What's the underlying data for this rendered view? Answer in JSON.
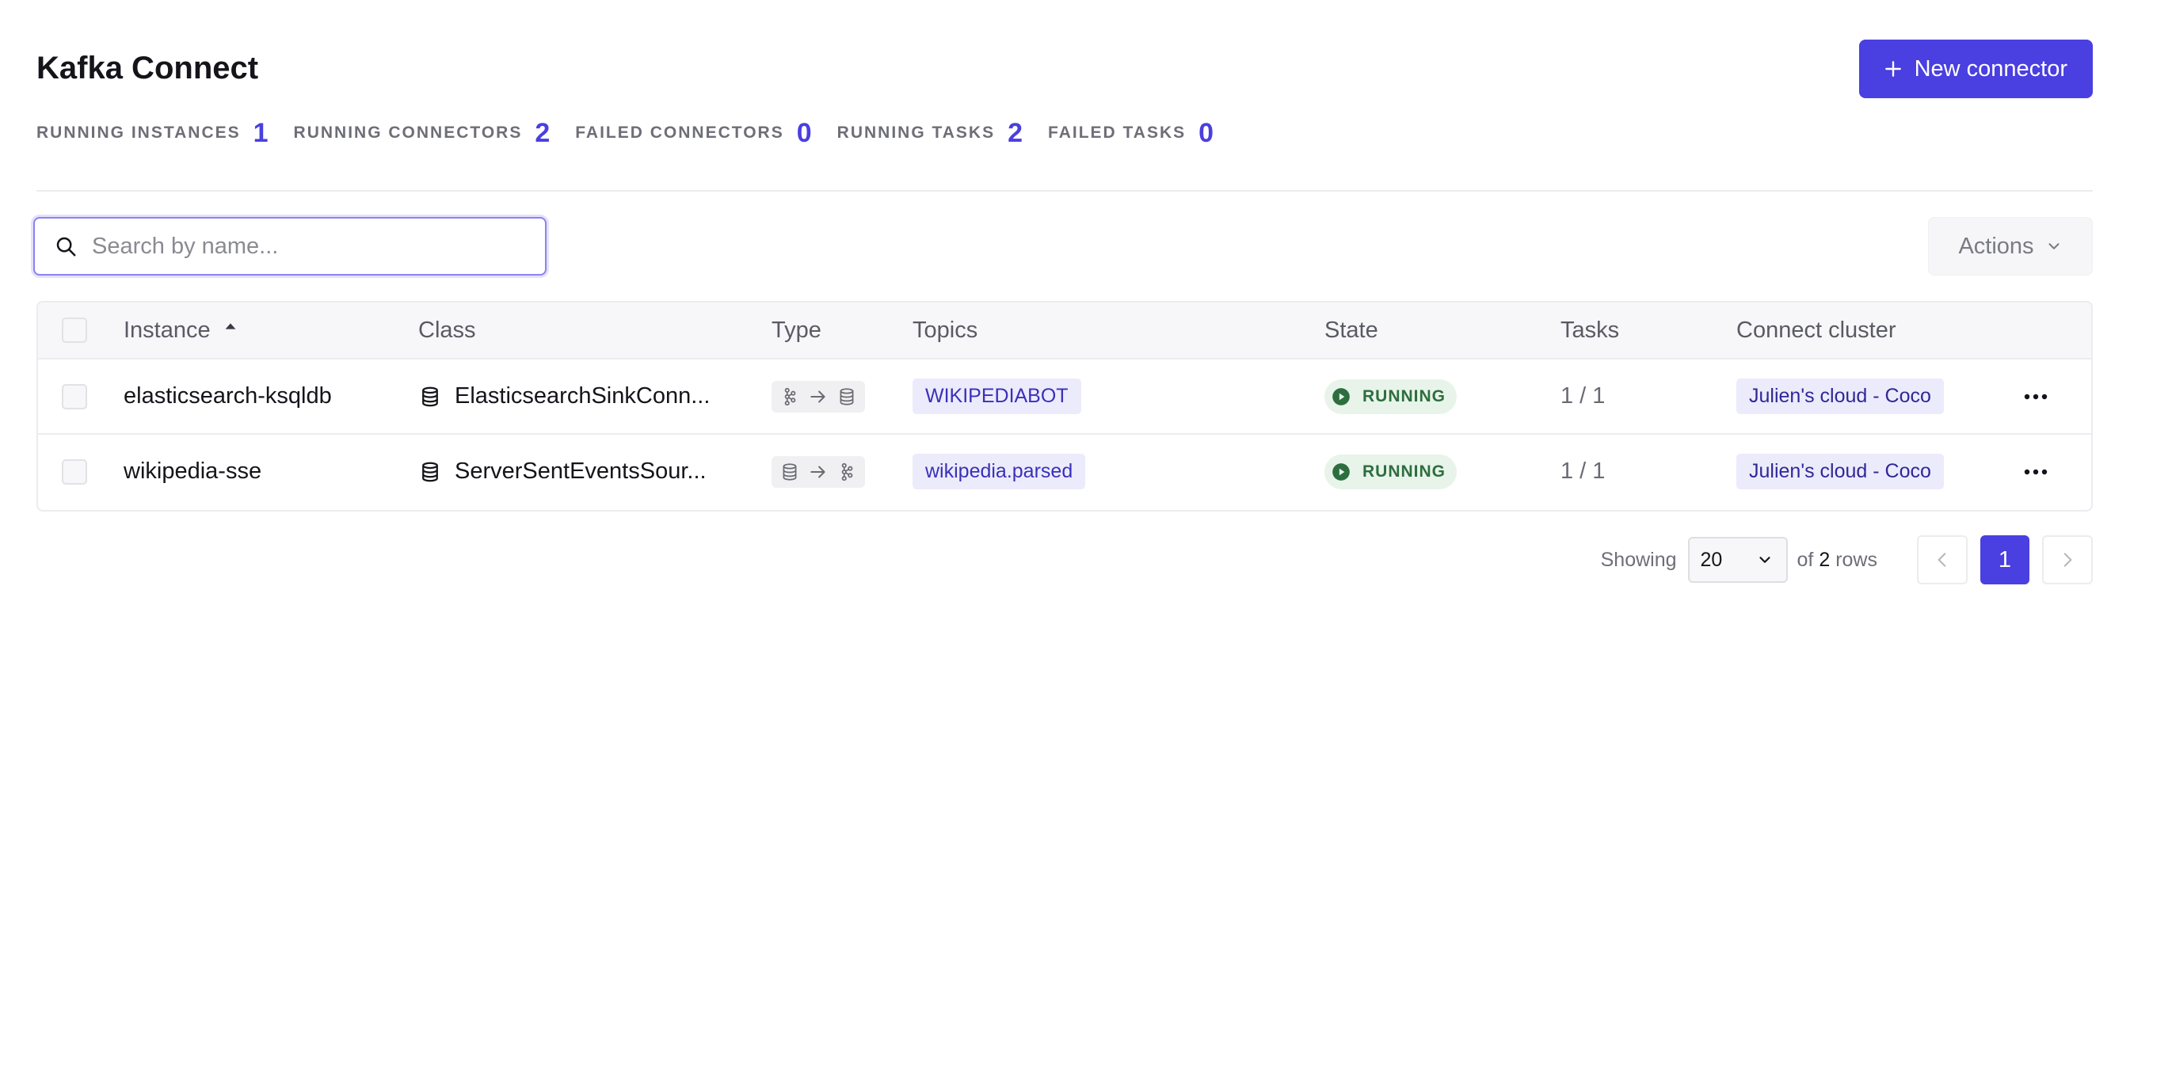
{
  "header": {
    "title": "Kafka Connect",
    "new_button_label": "New connector"
  },
  "stats": [
    {
      "label": "RUNNING INSTANCES",
      "value": "1"
    },
    {
      "label": "RUNNING CONNECTORS",
      "value": "2"
    },
    {
      "label": "FAILED CONNECTORS",
      "value": "0"
    },
    {
      "label": "RUNNING TASKS",
      "value": "2"
    },
    {
      "label": "FAILED TASKS",
      "value": "0"
    }
  ],
  "toolbar": {
    "search_placeholder": "Search by name...",
    "search_value": "",
    "actions_label": "Actions"
  },
  "table": {
    "columns": {
      "instance": "Instance",
      "class": "Class",
      "type": "Type",
      "topics": "Topics",
      "state": "State",
      "tasks": "Tasks",
      "cluster": "Connect cluster"
    },
    "sort_column": "instance",
    "rows": [
      {
        "instance": "elasticsearch-ksqldb",
        "class": "ElasticsearchSinkConn...",
        "type_icons": [
          "kafka-icon",
          "arrow-right-icon",
          "database-icon"
        ],
        "topic": "WIKIPEDIABOT",
        "state": "RUNNING",
        "tasks": "1 / 1",
        "cluster": "Julien's cloud - Coco"
      },
      {
        "instance": "wikipedia-sse",
        "class": "ServerSentEventsSour...",
        "type_icons": [
          "database-icon",
          "arrow-right-icon",
          "kafka-icon"
        ],
        "topic": "wikipedia.parsed",
        "state": "RUNNING",
        "tasks": "1 / 1",
        "cluster": "Julien's cloud - Coco"
      }
    ]
  },
  "pagination": {
    "showing_label": "Showing",
    "page_size": "20",
    "of_label": "of",
    "total_rows": "2",
    "rows_label": "rows",
    "current_page": "1"
  },
  "colors": {
    "accent": "#4a3fe0",
    "running_bg": "#e8f4ea",
    "running_text": "#2d6e3e",
    "tag_bg": "#ecebfc"
  }
}
